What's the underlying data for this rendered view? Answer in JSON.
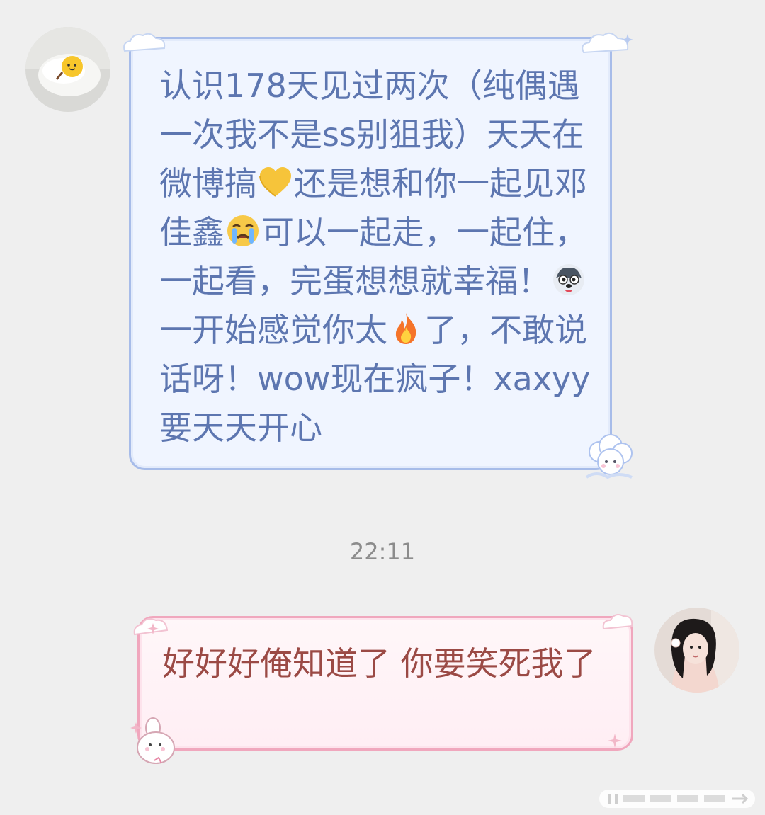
{
  "conversation": {
    "incoming": {
      "text_parts": [
        "认识178天见过两次（纯偶遇一次我不是ss别狙我）天天在微博搞",
        "还是想和你一起见邓佳鑫",
        "可以一起走，一起住，一起看，完蛋想想就幸福！",
        "一开始感觉你太",
        "了，不敢说话呀！wow现在疯子！xaxyy要天天开心"
      ],
      "emojis": [
        "yellow-heart-icon",
        "crying-face-icon",
        "husky-dog-icon",
        "fire-icon"
      ]
    },
    "timestamp": "22:11",
    "outgoing": {
      "text": "好好好俺知道了 你要笑死我了"
    }
  },
  "colors": {
    "background": "#efefef",
    "incoming_text": "#5d76b0",
    "incoming_bubble": "#f0f5ff",
    "incoming_border": "#a7bce9",
    "outgoing_text": "#9b4a45",
    "outgoing_bubble": "#fff7f9",
    "outgoing_border": "#f0a7bd",
    "timestamp": "#8c8c8c"
  }
}
